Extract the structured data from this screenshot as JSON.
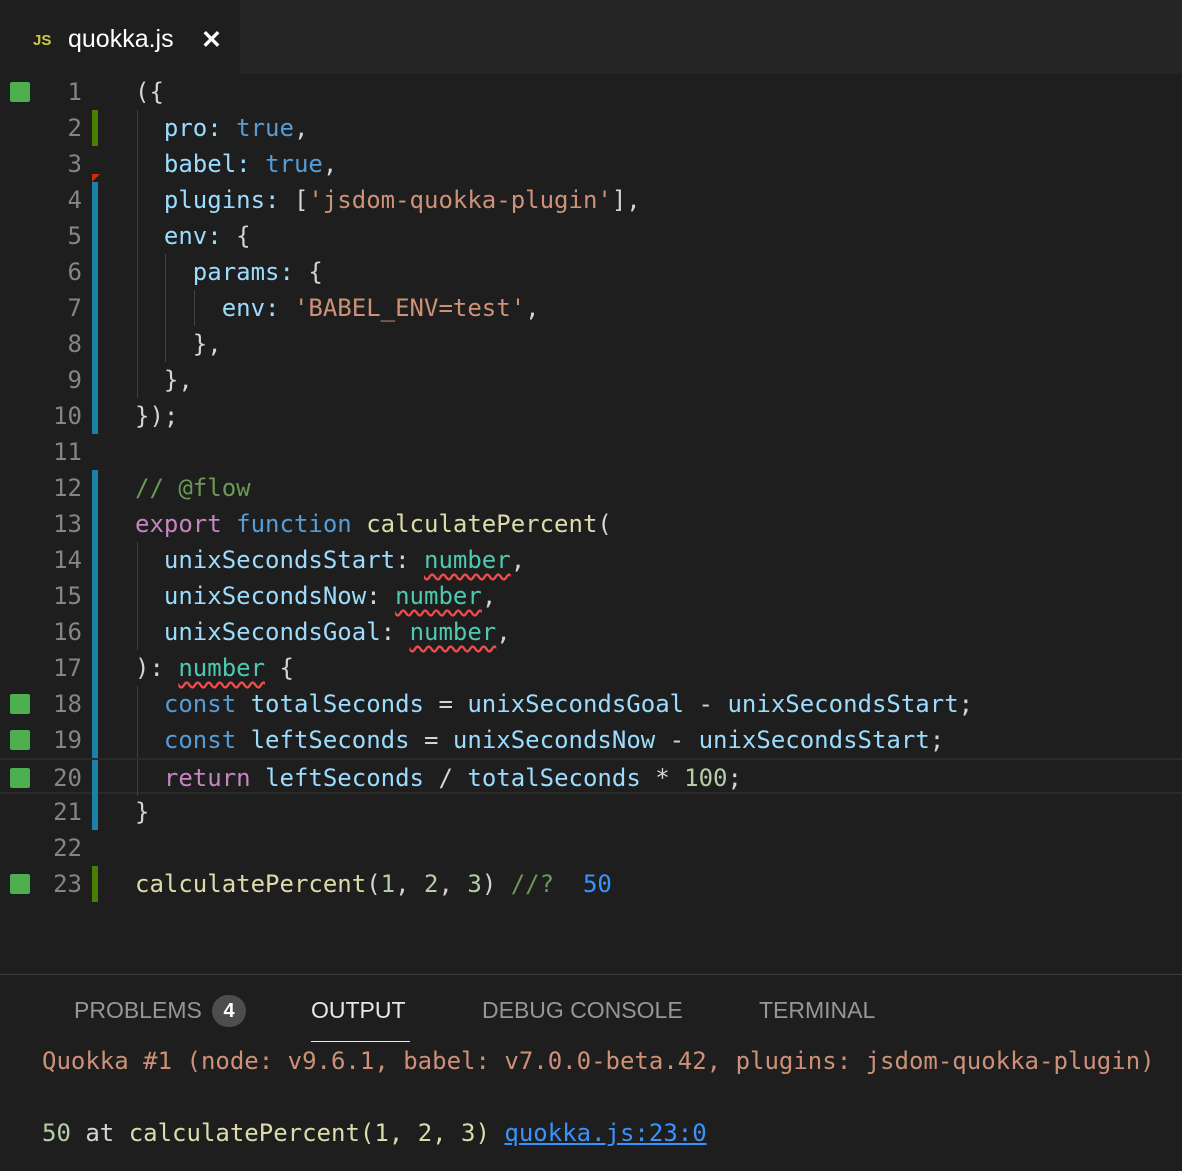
{
  "tab": {
    "icon": "JS",
    "title": "quokka.js",
    "close": "✕"
  },
  "editor": {
    "line_numbers": [
      "1",
      "2",
      "3",
      "4",
      "5",
      "6",
      "7",
      "8",
      "9",
      "10",
      "11",
      "12",
      "13",
      "14",
      "15",
      "16",
      "17",
      "18",
      "19",
      "20",
      "21",
      "22",
      "23"
    ],
    "code": {
      "l1_open": "({",
      "l2_key": "pro:",
      "l2_val": "true",
      "l2_punct": ",",
      "l3_key": "babel:",
      "l3_val": "true",
      "l3_punct": ",",
      "l4_key": "plugins:",
      "l4_open": " [",
      "l4_str": "'jsdom-quokka-plugin'",
      "l4_close": "],",
      "l5_key": "env:",
      "l5_open": " {",
      "l6_key": "params:",
      "l6_open": " {",
      "l7_key": "env:",
      "l7_str": "'BABEL_ENV=test'",
      "l7_punct": ",",
      "l8": "},",
      "l9": "},",
      "l10": "});",
      "l12_comment": "// @flow",
      "l13_export": "export",
      "l13_function": "function",
      "l13_name": "calculatePercent",
      "l13_paren": "(",
      "l14_param": "unixSecondsStart",
      "l15_param": "unixSecondsNow",
      "l16_param": "unixSecondsGoal",
      "param_colon": ": ",
      "param_type": "number",
      "param_comma": ",",
      "l17_close": "): ",
      "l17_type": "number",
      "l17_brace": " {",
      "l18_const": "const",
      "l18_var": "totalSeconds",
      "l18_eq": " = ",
      "l18_a": "unixSecondsGoal",
      "l18_minus": " - ",
      "l18_b": "unixSecondsStart",
      "l18_semi": ";",
      "l19_const": "const",
      "l19_var": "leftSeconds",
      "l19_eq": " = ",
      "l19_a": "unixSecondsNow",
      "l19_minus": " - ",
      "l19_b": "unixSecondsStart",
      "l19_semi": ";",
      "l20_return": "return",
      "l20_a": "leftSeconds",
      "l20_div": " / ",
      "l20_b": "totalSeconds",
      "l20_mul": " * ",
      "l20_num": "100",
      "l20_semi": ";",
      "l21": "}",
      "l23_fn": "calculatePercent",
      "l23_open": "(",
      "l23_n1": "1",
      "l23_c1": ", ",
      "l23_n2": "2",
      "l23_c2": ", ",
      "l23_n3": "3",
      "l23_close": ") ",
      "l23_comment": "//?",
      "l23_result": "50"
    },
    "colors": {
      "coverage": "#4caf50",
      "gutter_blue": "#1b81a8",
      "gutter_green": "#487e02",
      "error_squiggle": "#f14c4c"
    }
  },
  "panel": {
    "tabs": [
      "PROBLEMS",
      "OUTPUT",
      "DEBUG CONSOLE",
      "TERMINAL"
    ],
    "active_tab": "OUTPUT",
    "problems_count": "4",
    "output_header": "Quokka #1 (node: v9.6.1, babel: v7.0.0-beta.42, plugins: jsdom-quokka-plugin)",
    "result_value": "50",
    "result_at": " at ",
    "result_call": "calculatePercent(1, 2, 3)",
    "result_link": "quokka.js:23:0"
  }
}
